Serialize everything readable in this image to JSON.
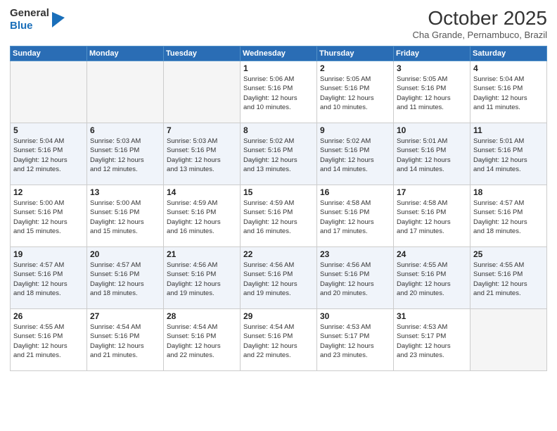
{
  "header": {
    "logo_line1": "General",
    "logo_line2": "Blue",
    "month": "October 2025",
    "location": "Cha Grande, Pernambuco, Brazil"
  },
  "days_of_week": [
    "Sunday",
    "Monday",
    "Tuesday",
    "Wednesday",
    "Thursday",
    "Friday",
    "Saturday"
  ],
  "weeks": [
    [
      {
        "day": "",
        "info": ""
      },
      {
        "day": "",
        "info": ""
      },
      {
        "day": "",
        "info": ""
      },
      {
        "day": "1",
        "info": "Sunrise: 5:06 AM\nSunset: 5:16 PM\nDaylight: 12 hours\nand 10 minutes."
      },
      {
        "day": "2",
        "info": "Sunrise: 5:05 AM\nSunset: 5:16 PM\nDaylight: 12 hours\nand 10 minutes."
      },
      {
        "day": "3",
        "info": "Sunrise: 5:05 AM\nSunset: 5:16 PM\nDaylight: 12 hours\nand 11 minutes."
      },
      {
        "day": "4",
        "info": "Sunrise: 5:04 AM\nSunset: 5:16 PM\nDaylight: 12 hours\nand 11 minutes."
      }
    ],
    [
      {
        "day": "5",
        "info": "Sunrise: 5:04 AM\nSunset: 5:16 PM\nDaylight: 12 hours\nand 12 minutes."
      },
      {
        "day": "6",
        "info": "Sunrise: 5:03 AM\nSunset: 5:16 PM\nDaylight: 12 hours\nand 12 minutes."
      },
      {
        "day": "7",
        "info": "Sunrise: 5:03 AM\nSunset: 5:16 PM\nDaylight: 12 hours\nand 13 minutes."
      },
      {
        "day": "8",
        "info": "Sunrise: 5:02 AM\nSunset: 5:16 PM\nDaylight: 12 hours\nand 13 minutes."
      },
      {
        "day": "9",
        "info": "Sunrise: 5:02 AM\nSunset: 5:16 PM\nDaylight: 12 hours\nand 14 minutes."
      },
      {
        "day": "10",
        "info": "Sunrise: 5:01 AM\nSunset: 5:16 PM\nDaylight: 12 hours\nand 14 minutes."
      },
      {
        "day": "11",
        "info": "Sunrise: 5:01 AM\nSunset: 5:16 PM\nDaylight: 12 hours\nand 14 minutes."
      }
    ],
    [
      {
        "day": "12",
        "info": "Sunrise: 5:00 AM\nSunset: 5:16 PM\nDaylight: 12 hours\nand 15 minutes."
      },
      {
        "day": "13",
        "info": "Sunrise: 5:00 AM\nSunset: 5:16 PM\nDaylight: 12 hours\nand 15 minutes."
      },
      {
        "day": "14",
        "info": "Sunrise: 4:59 AM\nSunset: 5:16 PM\nDaylight: 12 hours\nand 16 minutes."
      },
      {
        "day": "15",
        "info": "Sunrise: 4:59 AM\nSunset: 5:16 PM\nDaylight: 12 hours\nand 16 minutes."
      },
      {
        "day": "16",
        "info": "Sunrise: 4:58 AM\nSunset: 5:16 PM\nDaylight: 12 hours\nand 17 minutes."
      },
      {
        "day": "17",
        "info": "Sunrise: 4:58 AM\nSunset: 5:16 PM\nDaylight: 12 hours\nand 17 minutes."
      },
      {
        "day": "18",
        "info": "Sunrise: 4:57 AM\nSunset: 5:16 PM\nDaylight: 12 hours\nand 18 minutes."
      }
    ],
    [
      {
        "day": "19",
        "info": "Sunrise: 4:57 AM\nSunset: 5:16 PM\nDaylight: 12 hours\nand 18 minutes."
      },
      {
        "day": "20",
        "info": "Sunrise: 4:57 AM\nSunset: 5:16 PM\nDaylight: 12 hours\nand 18 minutes."
      },
      {
        "day": "21",
        "info": "Sunrise: 4:56 AM\nSunset: 5:16 PM\nDaylight: 12 hours\nand 19 minutes."
      },
      {
        "day": "22",
        "info": "Sunrise: 4:56 AM\nSunset: 5:16 PM\nDaylight: 12 hours\nand 19 minutes."
      },
      {
        "day": "23",
        "info": "Sunrise: 4:56 AM\nSunset: 5:16 PM\nDaylight: 12 hours\nand 20 minutes."
      },
      {
        "day": "24",
        "info": "Sunrise: 4:55 AM\nSunset: 5:16 PM\nDaylight: 12 hours\nand 20 minutes."
      },
      {
        "day": "25",
        "info": "Sunrise: 4:55 AM\nSunset: 5:16 PM\nDaylight: 12 hours\nand 21 minutes."
      }
    ],
    [
      {
        "day": "26",
        "info": "Sunrise: 4:55 AM\nSunset: 5:16 PM\nDaylight: 12 hours\nand 21 minutes."
      },
      {
        "day": "27",
        "info": "Sunrise: 4:54 AM\nSunset: 5:16 PM\nDaylight: 12 hours\nand 21 minutes."
      },
      {
        "day": "28",
        "info": "Sunrise: 4:54 AM\nSunset: 5:16 PM\nDaylight: 12 hours\nand 22 minutes."
      },
      {
        "day": "29",
        "info": "Sunrise: 4:54 AM\nSunset: 5:16 PM\nDaylight: 12 hours\nand 22 minutes."
      },
      {
        "day": "30",
        "info": "Sunrise: 4:53 AM\nSunset: 5:17 PM\nDaylight: 12 hours\nand 23 minutes."
      },
      {
        "day": "31",
        "info": "Sunrise: 4:53 AM\nSunset: 5:17 PM\nDaylight: 12 hours\nand 23 minutes."
      },
      {
        "day": "",
        "info": ""
      }
    ]
  ]
}
